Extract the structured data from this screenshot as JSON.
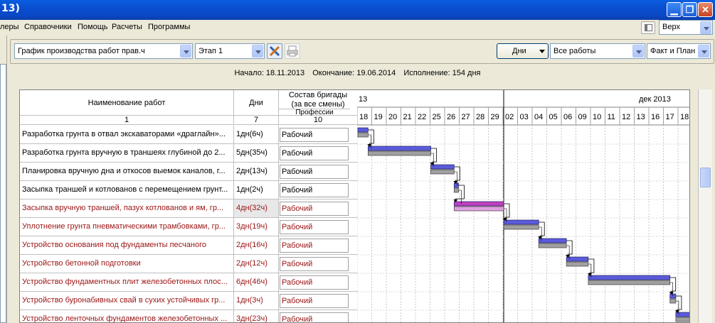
{
  "window": {
    "title": "13)"
  },
  "menu": [
    "леры",
    "Справочники",
    "Помощь",
    "Расчеты",
    "Программы"
  ],
  "mdi": {
    "position_value": "Верх"
  },
  "toolbar": {
    "schedule": "График производства работ прав.ч",
    "stage": "Этап 1",
    "units_button": "Дни",
    "filter": "Все работы",
    "mode": "Факт и План"
  },
  "info": {
    "start": "Начало: 18.11.2013",
    "end": "Окончание: 19.06.2014",
    "duration": "Исполнение: 154 дня"
  },
  "table": {
    "headers": {
      "name": "Наименование работ",
      "days": "Дни",
      "crew_line1": "Состав бригады",
      "crew_line2": "(за все смены)",
      "professions": "Профессии",
      "col1": "1",
      "col7": "7",
      "col10": "10"
    },
    "rows": [
      {
        "name": "Разработка грунта в отвал экскаваторами «драглайн»...",
        "days": "1дн(6ч)",
        "prof": "Рабочий",
        "red": false
      },
      {
        "name": "Разработка грунта вручную в траншеях глубиной до 2...",
        "days": "5дн(35ч)",
        "prof": "Рабочий",
        "red": false
      },
      {
        "name": "Планировка вручную дна и откосов выемок каналов, г...",
        "days": "2дн(13ч)",
        "prof": "Рабочий",
        "red": false
      },
      {
        "name": "Засыпка траншей и котлованов с перемещением грунт...",
        "days": "1дн(2ч)",
        "prof": "Рабочий",
        "red": false
      },
      {
        "name": "Засыпка вручную траншей, пазух котлованов и ям, гр...",
        "days": "4дн(32ч)",
        "prof": "Рабочий",
        "red": true
      },
      {
        "name": "Уплотнение грунта пневматическими трамбовками, гр...",
        "days": "3дн(19ч)",
        "prof": "Рабочий",
        "red": true
      },
      {
        "name": "Устройство основания под фундаменты песчаного",
        "days": "2дн(16ч)",
        "prof": "Рабочий",
        "red": true
      },
      {
        "name": "Устройство бетонной подготовки",
        "days": "2дн(12ч)",
        "prof": "Рабочий",
        "red": true
      },
      {
        "name": "Устройство фундаментных плит железобетонных плос...",
        "days": "6дн(46ч)",
        "prof": "Рабочий",
        "red": true
      },
      {
        "name": "Устройство буронабивных свай в сухих устойчивых гр...",
        "days": "1дн(3ч)",
        "prof": "Рабочий",
        "red": true
      },
      {
        "name": "Устройство ленточных фундаментов железобетонных ...",
        "days": "3дн(23ч)",
        "prof": "Рабочий",
        "red": true
      }
    ]
  },
  "gantt": {
    "month_left": "13",
    "month_right": "дек 2013",
    "days": [
      "18",
      "19",
      "20",
      "21",
      "22",
      "25",
      "26",
      "27",
      "28",
      "29",
      "02",
      "03",
      "04",
      "05",
      "06",
      "09",
      "10",
      "11",
      "12",
      "13",
      "16",
      "17",
      "18"
    ],
    "colors": {
      "plan": "#5b5bdc",
      "fact": "#a0a0a0",
      "selected_plan": "#c040c0",
      "selected_fact": "#e0a0e0"
    },
    "bars": [
      {
        "row": 0,
        "start": 0.0,
        "len": 0.7
      },
      {
        "row": 1,
        "start": 0.7,
        "len": 4.3
      },
      {
        "row": 2,
        "start": 5.0,
        "len": 1.6
      },
      {
        "row": 3,
        "start": 6.6,
        "len": 0.3
      },
      {
        "row": 4,
        "start": 6.6,
        "len": 3.4,
        "selected": true
      },
      {
        "row": 5,
        "start": 10.0,
        "len": 2.4
      },
      {
        "row": 6,
        "start": 12.4,
        "len": 1.9
      },
      {
        "row": 7,
        "start": 14.3,
        "len": 1.5
      },
      {
        "row": 8,
        "start": 15.8,
        "len": 5.6
      },
      {
        "row": 9,
        "start": 21.4,
        "len": 0.4
      },
      {
        "row": 10,
        "start": 21.8,
        "len": 1.5
      }
    ]
  }
}
